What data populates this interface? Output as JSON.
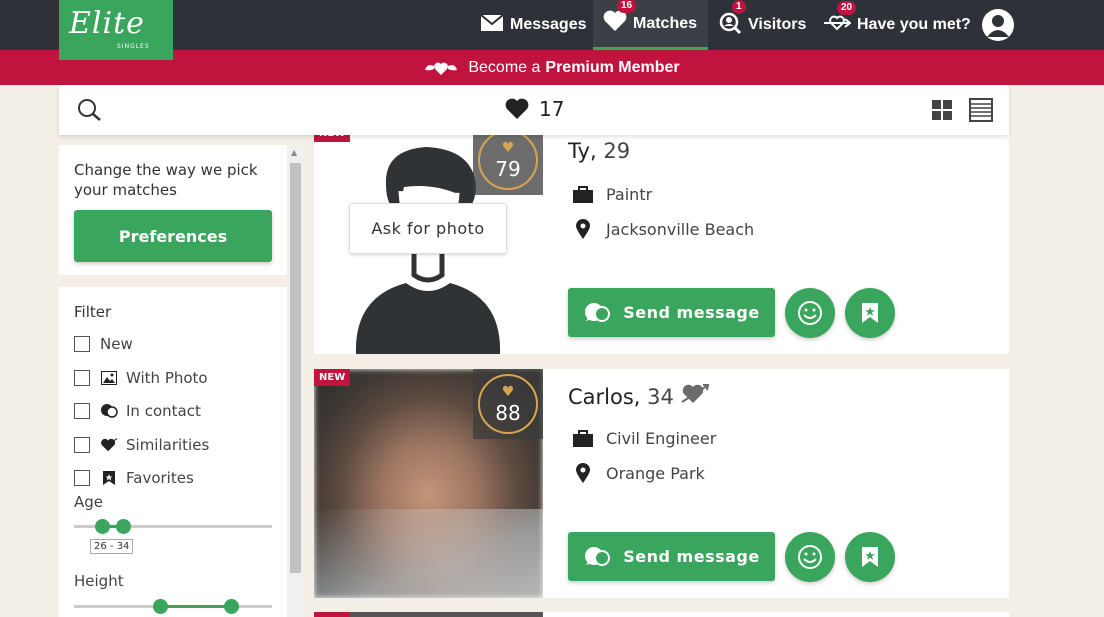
{
  "brand": {
    "logo_text": "Elite",
    "logo_sub": "SINGLES",
    "accent": "#3aa55c",
    "premium_color": "#c0133d"
  },
  "nav": {
    "items": [
      {
        "label": "Messages",
        "icon": "envelope-icon",
        "badge": ""
      },
      {
        "label": "Matches",
        "icon": "heart-icon",
        "badge": "16"
      },
      {
        "label": "Visitors",
        "icon": "visitor-icon",
        "badge": "1"
      },
      {
        "label": "Have you met?",
        "icon": "arrow-heart-icon",
        "badge": "20"
      }
    ],
    "profile_icon": "user-avatar-icon"
  },
  "premium": {
    "prefix": "Become a",
    "bold": "Premium Member",
    "icon": "winged-heart-icon"
  },
  "toolbar": {
    "likes_count": "17",
    "search_icon": "search-icon",
    "grid_icon": "grid-view-icon",
    "list_icon": "list-view-icon"
  },
  "sidebar": {
    "preferences_text": "Change the way we pick your matches",
    "preferences_button": "Preferences",
    "filter_title": "Filter",
    "filters": [
      {
        "label": "New",
        "icon": ""
      },
      {
        "label": "With Photo",
        "icon": "photo-icon"
      },
      {
        "label": "In contact",
        "icon": "chat-bubbles-icon"
      },
      {
        "label": "Similarities",
        "icon": "heart-arrow-icon"
      },
      {
        "label": "Favorites",
        "icon": "bookmark-star-icon"
      }
    ],
    "age_label": "Age",
    "age_range": "26 - 34",
    "height_label": "Height"
  },
  "profiles": [
    {
      "name": "Ty",
      "age": "29",
      "new_badge": "NEW",
      "score": "79",
      "job": "Paintr",
      "location": "Jacksonville Beach",
      "ask_photo": "Ask for photo",
      "send_label": "Send message",
      "has_similarity": false
    },
    {
      "name": "Carlos",
      "age": "34",
      "new_badge": "NEW",
      "score": "88",
      "job": "Civil Engineer",
      "location": "Orange Park",
      "send_label": "Send message",
      "has_similarity": true
    }
  ]
}
